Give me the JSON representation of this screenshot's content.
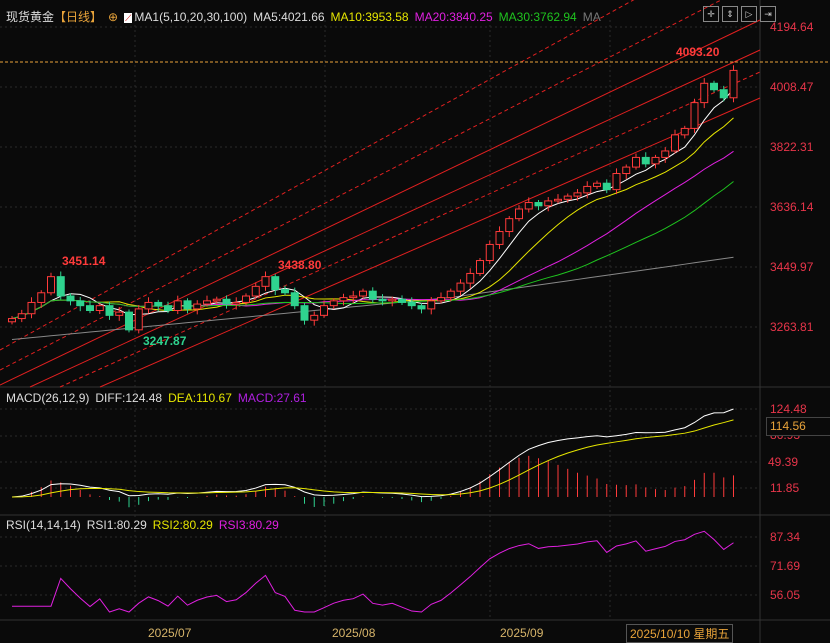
{
  "header": {
    "symbol": "现货黄金",
    "period": "【日线】",
    "ma_label": "MA1(5,10,20,30,100)",
    "ma5": "MA5:4021.66",
    "ma10": "MA10:3953.58",
    "ma20": "MA20:3840.25",
    "ma30": "MA30:3762.94",
    "ma_more": "MA"
  },
  "macd_header": {
    "label": "MACD(26,12,9)",
    "diff": "DIFF:124.48",
    "dea": "DEA:110.67",
    "macd": "MACD:27.61"
  },
  "rsi_header": {
    "label": "RSI(14,14,14)",
    "rsi1": "RSI1:80.29",
    "rsi2": "RSI2:80.29",
    "rsi3": "RSI3:80.29"
  },
  "colors": {
    "up": "#ff3b3b",
    "down": "#2fd38f",
    "ma5": "#ffffff",
    "ma10": "#e6e600",
    "ma20": "#e020e0",
    "ma30": "#1fc41f",
    "ma100": "#888888",
    "axis": "#e8354a"
  },
  "chart_data": {
    "type": "candlestick",
    "title": "现货黄金 日线",
    "price_ticks": [
      "4194.64",
      "4008.47",
      "3822.31",
      "3636.14",
      "3449.97",
      "3263.81"
    ],
    "price_range": [
      3263.81,
      4194.64
    ],
    "annotations": {
      "high1": "3451.14",
      "low1": "3247.87",
      "high2": "3438.80",
      "high3": "4093.20"
    },
    "closes": [
      3290,
      3305,
      3340,
      3370,
      3420,
      3360,
      3345,
      3330,
      3315,
      3330,
      3300,
      3310,
      3255,
      3320,
      3340,
      3330,
      3315,
      3345,
      3320,
      3335,
      3345,
      3350,
      3335,
      3340,
      3360,
      3390,
      3420,
      3380,
      3370,
      3330,
      3285,
      3300,
      3330,
      3345,
      3355,
      3360,
      3375,
      3350,
      3345,
      3350,
      3340,
      3330,
      3320,
      3345,
      3355,
      3375,
      3400,
      3430,
      3470,
      3520,
      3560,
      3600,
      3630,
      3650,
      3640,
      3655,
      3660,
      3670,
      3680,
      3700,
      3710,
      3690,
      3740,
      3760,
      3790,
      3770,
      3790,
      3810,
      3860,
      3880,
      3960,
      4020,
      4000,
      3975,
      4060
    ],
    "macd_ticks": [
      "124.48",
      "86.93",
      "49.39",
      "11.85"
    ],
    "macd_current": "114.56",
    "rsi_ticks": [
      "87.34",
      "71.69",
      "56.05"
    ],
    "x_labels": [
      "2025/07",
      "2025/08",
      "2025/09"
    ],
    "cursor_date": "2025/10/10 星期五"
  }
}
